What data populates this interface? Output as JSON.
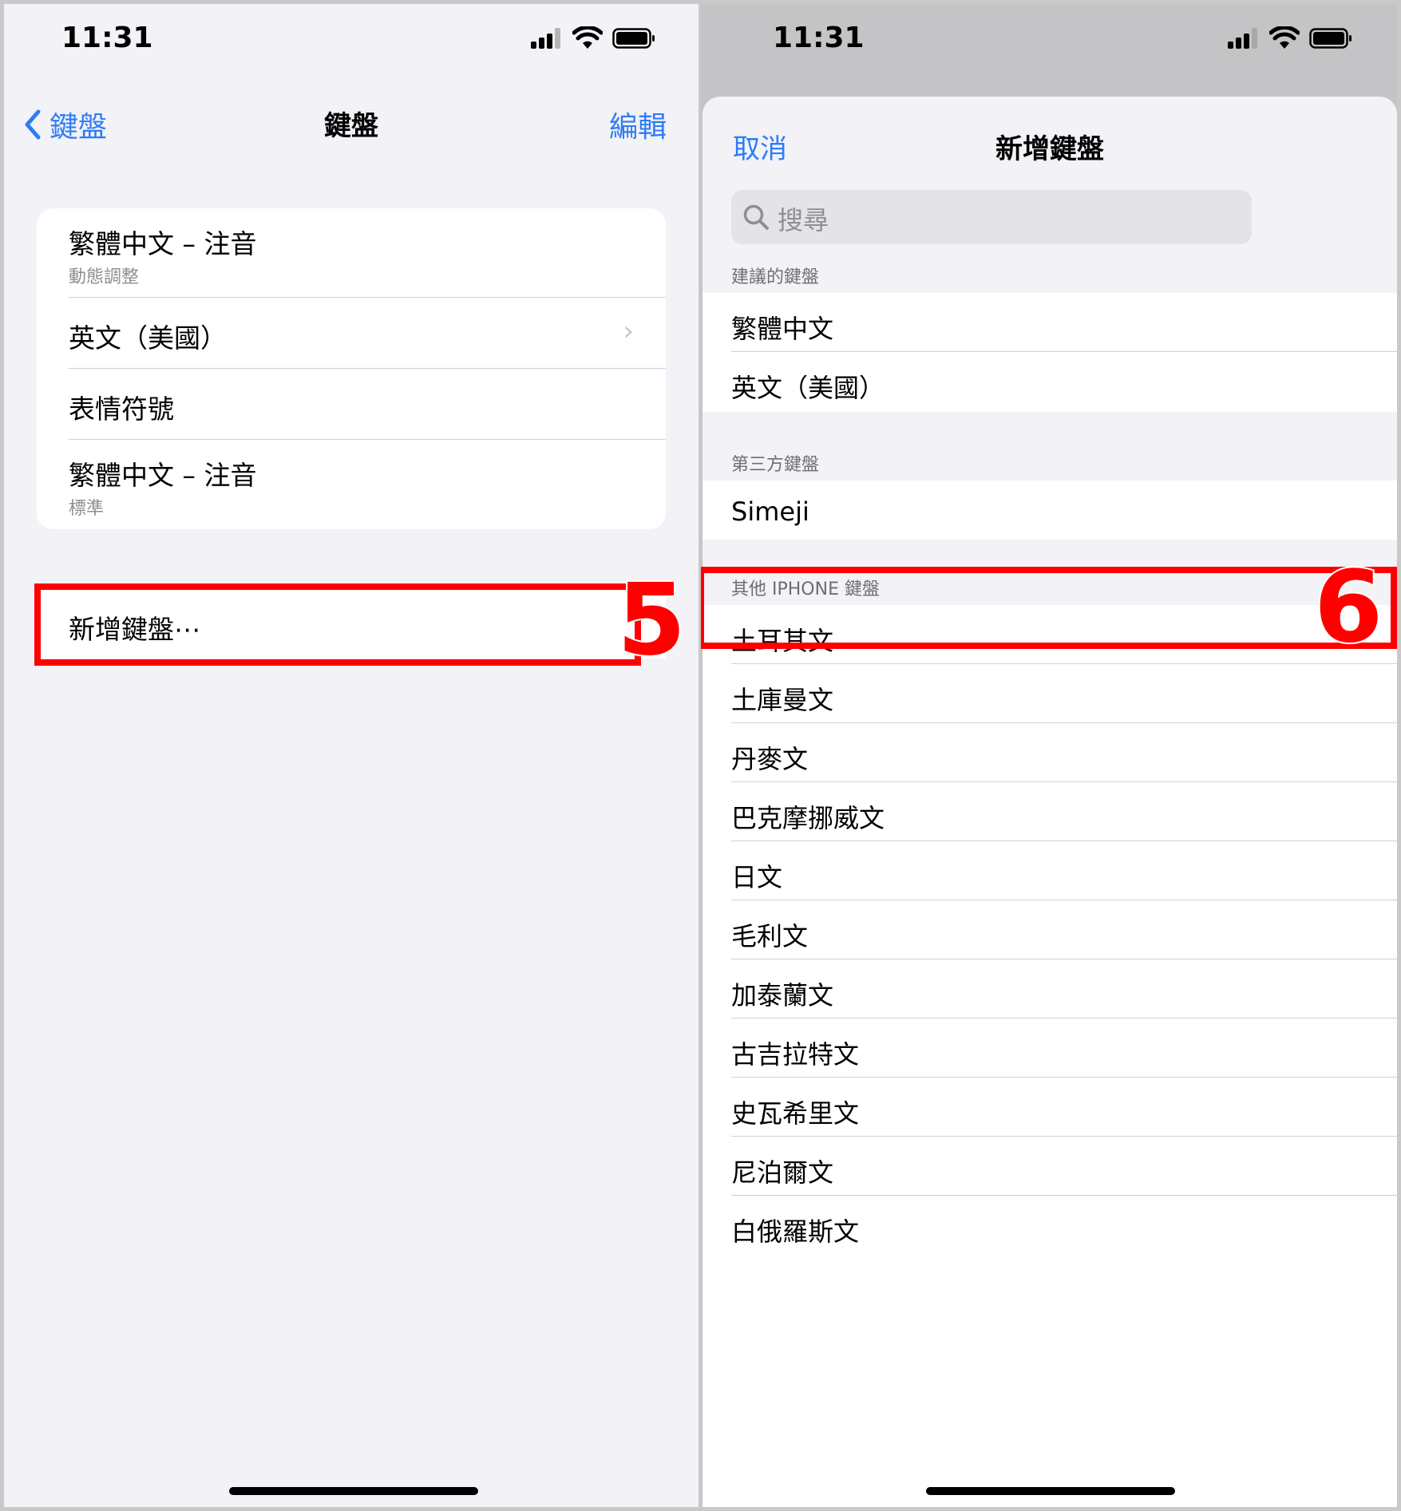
{
  "left": {
    "status": {
      "time": "11:31"
    },
    "nav": {
      "back_label": "鍵盤",
      "title": "鍵盤",
      "edit_label": "編輯"
    },
    "keyboards": [
      {
        "title": "繁體中文 – 注音",
        "subtitle": "動態調整"
      },
      {
        "title": "英文（美國）",
        "subtitle": ""
      },
      {
        "title": "表情符號",
        "subtitle": ""
      },
      {
        "title": "繁體中文 – 注音",
        "subtitle": "標準"
      }
    ],
    "add_keyboard_label": "新增鍵盤⋯",
    "step_label": "5"
  },
  "right": {
    "status": {
      "time": "11:31"
    },
    "sheet": {
      "cancel_label": "取消",
      "title": "新增鍵盤",
      "search_placeholder": "搜尋"
    },
    "suggested": {
      "header": "建議的鍵盤",
      "items": [
        "繁體中文",
        "英文（美國）"
      ]
    },
    "third_party": {
      "header": "第三方鍵盤",
      "items": [
        "Simeji"
      ]
    },
    "other": {
      "header": "其他 IPHONE 鍵盤",
      "items": [
        "土耳其文",
        "土庫曼文",
        "丹麥文",
        "巴克摩挪威文",
        "日文",
        "毛利文",
        "加泰蘭文",
        "古吉拉特文",
        "史瓦希里文",
        "尼泊爾文",
        "白俄羅斯文"
      ]
    },
    "step_label": "6"
  },
  "colors": {
    "accent": "#2e7cf6",
    "highlight": "#ff0000",
    "background": "#f2f2f7"
  },
  "icons": [
    "signal-icon",
    "wifi-icon",
    "battery-icon",
    "chevron-left-icon",
    "chevron-right-icon",
    "search-icon"
  ]
}
